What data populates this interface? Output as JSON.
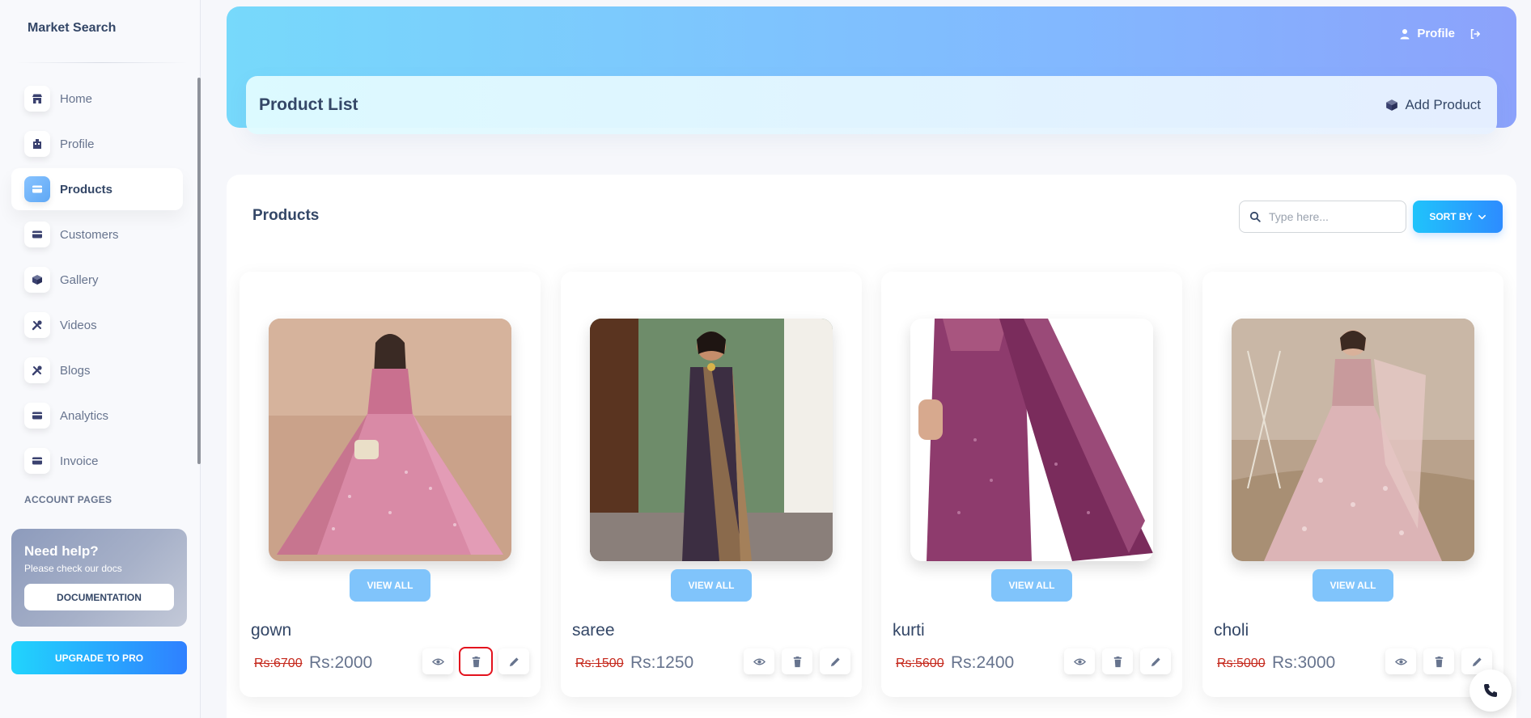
{
  "brand": "Market Search",
  "sidebar": {
    "items": [
      {
        "label": "Home",
        "icon": "shop-icon",
        "active": false
      },
      {
        "label": "Profile",
        "icon": "office-icon",
        "active": false
      },
      {
        "label": "Products",
        "icon": "card-icon",
        "active": true
      },
      {
        "label": "Customers",
        "icon": "card-icon",
        "active": false
      },
      {
        "label": "Gallery",
        "icon": "box-icon",
        "active": false
      },
      {
        "label": "Videos",
        "icon": "tools-icon",
        "active": false
      },
      {
        "label": "Blogs",
        "icon": "tools-icon",
        "active": false
      },
      {
        "label": "Analytics",
        "icon": "card-icon",
        "active": false
      },
      {
        "label": "Invoice",
        "icon": "card-icon",
        "active": false
      }
    ],
    "section_label": "ACCOUNT PAGES",
    "help": {
      "title": "Need help?",
      "subtitle": "Please check our docs",
      "button": "DOCUMENTATION"
    },
    "upgrade": "UPGRADE TO PRO"
  },
  "header": {
    "profile_label": "Profile",
    "title": "Product List",
    "add_product": "Add Product"
  },
  "main": {
    "title": "Products",
    "search_placeholder": "Type here...",
    "sort_label": "SORT BY"
  },
  "products": [
    {
      "name": "gown",
      "old_price": "Rs:6700",
      "new_price": "Rs:2000",
      "view_label": "VIEW ALL"
    },
    {
      "name": "saree",
      "old_price": "Rs:1500",
      "new_price": "Rs:1250",
      "view_label": "VIEW ALL"
    },
    {
      "name": "kurti",
      "old_price": "Rs:5600",
      "new_price": "Rs:2400",
      "view_label": "VIEW ALL"
    },
    {
      "name": "choli",
      "old_price": "Rs:5000",
      "new_price": "Rs:3000",
      "view_label": "VIEW ALL"
    }
  ],
  "colors": {
    "accent": "#2d8cff",
    "highlight_box": "#e3121d",
    "strike_price": "#c5281c",
    "view_button": "#80c4fb"
  }
}
